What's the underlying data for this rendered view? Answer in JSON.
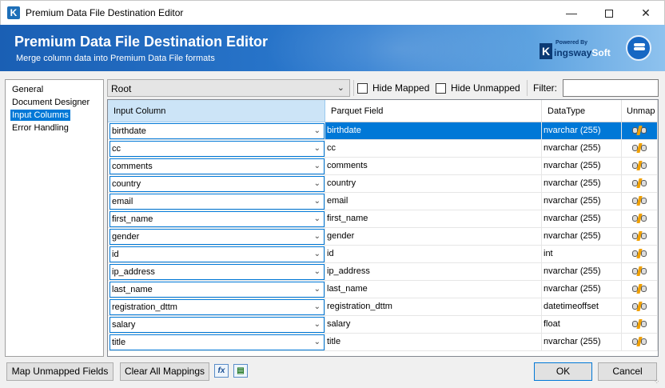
{
  "window": {
    "title": "Premium Data File Destination Editor",
    "app_icon_letter": "K"
  },
  "banner": {
    "title": "Premium Data File Destination Editor",
    "subtitle": "Merge column data into Premium Data File formats",
    "logo_powered": "Powered By",
    "logo_k": "K",
    "logo_name_a": "ingsway",
    "logo_name_b": "Soft"
  },
  "nav": {
    "items": [
      {
        "label": "General",
        "selected": false
      },
      {
        "label": "Document Designer",
        "selected": false
      },
      {
        "label": "Input Columns",
        "selected": true
      },
      {
        "label": "Error Handling",
        "selected": false
      }
    ]
  },
  "toolbar": {
    "root_value": "Root",
    "hide_mapped": "Hide Mapped",
    "hide_unmapped": "Hide Unmapped",
    "filter_label": "Filter:",
    "filter_value": ""
  },
  "grid": {
    "headers": {
      "input": "Input Column",
      "parquet": "Parquet Field",
      "type": "DataType",
      "unmap": "Unmap"
    },
    "rows": [
      {
        "input": "birthdate",
        "parquet": "birthdate",
        "type": "nvarchar (255)",
        "selected": true
      },
      {
        "input": "cc",
        "parquet": "cc",
        "type": "nvarchar (255)"
      },
      {
        "input": "comments",
        "parquet": "comments",
        "type": "nvarchar (255)"
      },
      {
        "input": "country",
        "parquet": "country",
        "type": "nvarchar (255)"
      },
      {
        "input": "email",
        "parquet": "email",
        "type": "nvarchar (255)"
      },
      {
        "input": "first_name",
        "parquet": "first_name",
        "type": "nvarchar (255)"
      },
      {
        "input": "gender",
        "parquet": "gender",
        "type": "nvarchar (255)"
      },
      {
        "input": "id",
        "parquet": "id",
        "type": "int"
      },
      {
        "input": "ip_address",
        "parquet": "ip_address",
        "type": "nvarchar (255)"
      },
      {
        "input": "last_name",
        "parquet": "last_name",
        "type": "nvarchar (255)"
      },
      {
        "input": "registration_dttm",
        "parquet": "registration_dttm",
        "type": "datetimeoffset"
      },
      {
        "input": "salary",
        "parquet": "salary",
        "type": "float"
      },
      {
        "input": "title",
        "parquet": "title",
        "type": "nvarchar (255)"
      }
    ]
  },
  "buttons": {
    "map_unmapped": "Map Unmapped Fields",
    "clear_all": "Clear All Mappings",
    "fx_icon_label": "fx",
    "ok": "OK",
    "cancel": "Cancel"
  },
  "colors": {
    "selection": "#0078d7",
    "banner": "#1a5fb4"
  }
}
